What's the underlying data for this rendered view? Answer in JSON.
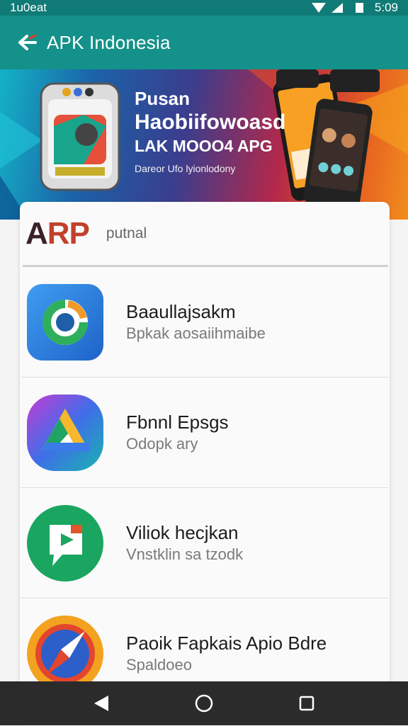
{
  "status_bar": {
    "left_text": "1u0eat",
    "time": "5:09",
    "icons": [
      "wifi-icon",
      "signal-icon",
      "battery-icon"
    ]
  },
  "app_bar": {
    "title": "APK Indonesia",
    "back_icon": "back-arrow-icon"
  },
  "banner": {
    "line1": "Pusan",
    "line2": "Haobiifowoasd",
    "line3": "LAK MOOO4 APG",
    "line4": "Dareor Ufo lyionlodony"
  },
  "brand": {
    "logo_a": "A",
    "logo_rp": "RP",
    "subtitle": "putnal"
  },
  "apps": [
    {
      "name": "Baaullajsakm",
      "desc": "Bpkak aosaiihmaibe",
      "icon": "sync-circle-icon"
    },
    {
      "name": "Fbnnl Epsgs",
      "desc": "Odopk ary",
      "icon": "triangle-drive-icon"
    },
    {
      "name": "Viliok hecjkan",
      "desc": "Vnstklin sa tzodk",
      "icon": "video-play-icon"
    },
    {
      "name": "Paoik Fapkais Apio Bdre",
      "desc": "Spaldoeo",
      "icon": "compass-icon"
    }
  ],
  "nav_bar": {
    "buttons": [
      "back-triangle-icon",
      "home-circle-icon",
      "recents-square-icon"
    ]
  },
  "colors": {
    "app_bar": "#14918a",
    "status_bar": "#0f7a76",
    "brand_red": "#c2412c",
    "nav_bar": "#2b2b2b"
  }
}
